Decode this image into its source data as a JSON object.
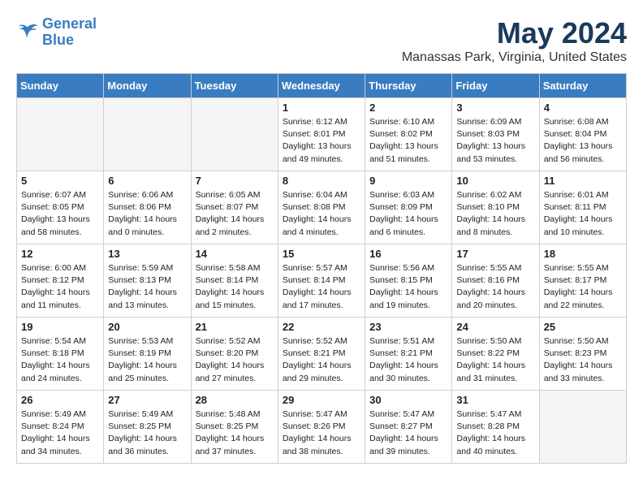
{
  "header": {
    "logo_line1": "General",
    "logo_line2": "Blue",
    "month": "May 2024",
    "location": "Manassas Park, Virginia, United States"
  },
  "days_of_week": [
    "Sunday",
    "Monday",
    "Tuesday",
    "Wednesday",
    "Thursday",
    "Friday",
    "Saturday"
  ],
  "weeks": [
    [
      {
        "day": "",
        "empty": true
      },
      {
        "day": "",
        "empty": true
      },
      {
        "day": "",
        "empty": true
      },
      {
        "day": "1",
        "sunrise": "6:12 AM",
        "sunset": "8:01 PM",
        "daylight": "13 hours and 49 minutes."
      },
      {
        "day": "2",
        "sunrise": "6:10 AM",
        "sunset": "8:02 PM",
        "daylight": "13 hours and 51 minutes."
      },
      {
        "day": "3",
        "sunrise": "6:09 AM",
        "sunset": "8:03 PM",
        "daylight": "13 hours and 53 minutes."
      },
      {
        "day": "4",
        "sunrise": "6:08 AM",
        "sunset": "8:04 PM",
        "daylight": "13 hours and 56 minutes."
      }
    ],
    [
      {
        "day": "5",
        "sunrise": "6:07 AM",
        "sunset": "8:05 PM",
        "daylight": "13 hours and 58 minutes."
      },
      {
        "day": "6",
        "sunrise": "6:06 AM",
        "sunset": "8:06 PM",
        "daylight": "14 hours and 0 minutes."
      },
      {
        "day": "7",
        "sunrise": "6:05 AM",
        "sunset": "8:07 PM",
        "daylight": "14 hours and 2 minutes."
      },
      {
        "day": "8",
        "sunrise": "6:04 AM",
        "sunset": "8:08 PM",
        "daylight": "14 hours and 4 minutes."
      },
      {
        "day": "9",
        "sunrise": "6:03 AM",
        "sunset": "8:09 PM",
        "daylight": "14 hours and 6 minutes."
      },
      {
        "day": "10",
        "sunrise": "6:02 AM",
        "sunset": "8:10 PM",
        "daylight": "14 hours and 8 minutes."
      },
      {
        "day": "11",
        "sunrise": "6:01 AM",
        "sunset": "8:11 PM",
        "daylight": "14 hours and 10 minutes."
      }
    ],
    [
      {
        "day": "12",
        "sunrise": "6:00 AM",
        "sunset": "8:12 PM",
        "daylight": "14 hours and 11 minutes."
      },
      {
        "day": "13",
        "sunrise": "5:59 AM",
        "sunset": "8:13 PM",
        "daylight": "14 hours and 13 minutes."
      },
      {
        "day": "14",
        "sunrise": "5:58 AM",
        "sunset": "8:14 PM",
        "daylight": "14 hours and 15 minutes."
      },
      {
        "day": "15",
        "sunrise": "5:57 AM",
        "sunset": "8:14 PM",
        "daylight": "14 hours and 17 minutes."
      },
      {
        "day": "16",
        "sunrise": "5:56 AM",
        "sunset": "8:15 PM",
        "daylight": "14 hours and 19 minutes."
      },
      {
        "day": "17",
        "sunrise": "5:55 AM",
        "sunset": "8:16 PM",
        "daylight": "14 hours and 20 minutes."
      },
      {
        "day": "18",
        "sunrise": "5:55 AM",
        "sunset": "8:17 PM",
        "daylight": "14 hours and 22 minutes."
      }
    ],
    [
      {
        "day": "19",
        "sunrise": "5:54 AM",
        "sunset": "8:18 PM",
        "daylight": "14 hours and 24 minutes."
      },
      {
        "day": "20",
        "sunrise": "5:53 AM",
        "sunset": "8:19 PM",
        "daylight": "14 hours and 25 minutes."
      },
      {
        "day": "21",
        "sunrise": "5:52 AM",
        "sunset": "8:20 PM",
        "daylight": "14 hours and 27 minutes."
      },
      {
        "day": "22",
        "sunrise": "5:52 AM",
        "sunset": "8:21 PM",
        "daylight": "14 hours and 29 minutes."
      },
      {
        "day": "23",
        "sunrise": "5:51 AM",
        "sunset": "8:21 PM",
        "daylight": "14 hours and 30 minutes."
      },
      {
        "day": "24",
        "sunrise": "5:50 AM",
        "sunset": "8:22 PM",
        "daylight": "14 hours and 31 minutes."
      },
      {
        "day": "25",
        "sunrise": "5:50 AM",
        "sunset": "8:23 PM",
        "daylight": "14 hours and 33 minutes."
      }
    ],
    [
      {
        "day": "26",
        "sunrise": "5:49 AM",
        "sunset": "8:24 PM",
        "daylight": "14 hours and 34 minutes."
      },
      {
        "day": "27",
        "sunrise": "5:49 AM",
        "sunset": "8:25 PM",
        "daylight": "14 hours and 36 minutes."
      },
      {
        "day": "28",
        "sunrise": "5:48 AM",
        "sunset": "8:25 PM",
        "daylight": "14 hours and 37 minutes."
      },
      {
        "day": "29",
        "sunrise": "5:47 AM",
        "sunset": "8:26 PM",
        "daylight": "14 hours and 38 minutes."
      },
      {
        "day": "30",
        "sunrise": "5:47 AM",
        "sunset": "8:27 PM",
        "daylight": "14 hours and 39 minutes."
      },
      {
        "day": "31",
        "sunrise": "5:47 AM",
        "sunset": "8:28 PM",
        "daylight": "14 hours and 40 minutes."
      },
      {
        "day": "",
        "empty": true
      }
    ]
  ]
}
